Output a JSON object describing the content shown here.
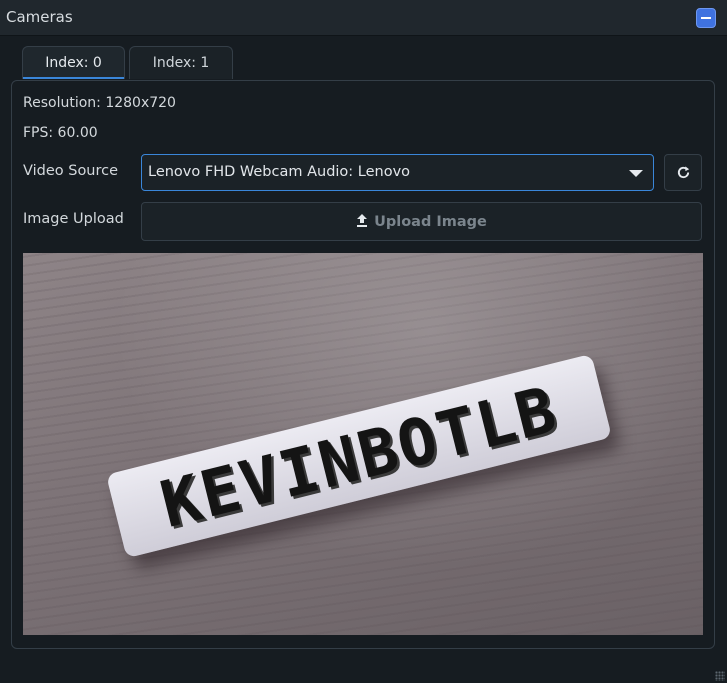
{
  "window": {
    "title": "Cameras",
    "collapse_icon": "minus-icon"
  },
  "tabs": [
    {
      "label": "Index: 0",
      "active": true
    },
    {
      "label": "Index: 1",
      "active": false
    }
  ],
  "info": {
    "resolution": "Resolution: 1280x720",
    "fps": "FPS: 60.00"
  },
  "video_source": {
    "label": "Video Source",
    "selected": "Lenovo FHD Webcam Audio: Lenovo",
    "refresh_icon": "refresh-icon"
  },
  "image_upload": {
    "label": "Image Upload",
    "button_label": "Upload Image",
    "icon": "upload-icon"
  },
  "camera_feed": {
    "plaque_text": "KEVINBOTLB"
  },
  "colors": {
    "accent": "#3a86d9",
    "collapse_button": "#3f72e0",
    "background": "#161c21"
  }
}
